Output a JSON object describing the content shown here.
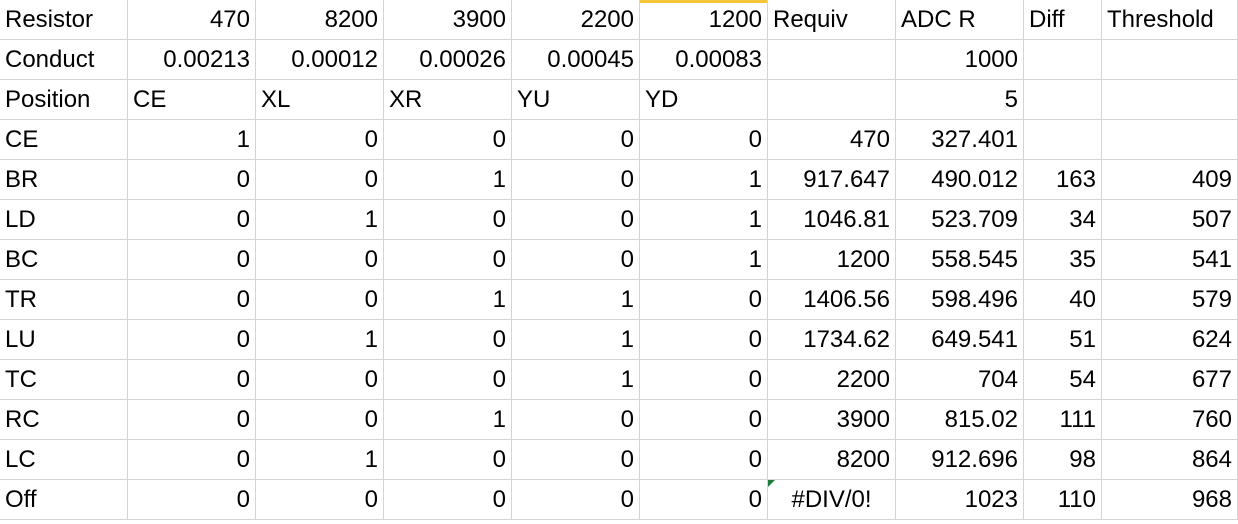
{
  "header_rows": [
    {
      "cells": [
        "Resistor",
        "470",
        "8200",
        "3900",
        "2200",
        "1200",
        "Requiv",
        "ADC R",
        "Diff",
        "Threshold"
      ]
    },
    {
      "cells": [
        "Conduct",
        "0.00213",
        "0.00012",
        "0.00026",
        "0.00045",
        "0.00083",
        "",
        "1000",
        "",
        ""
      ]
    },
    {
      "cells": [
        "Position",
        "CE",
        "XL",
        "XR",
        "YU",
        "YD",
        "",
        "5",
        "",
        ""
      ]
    }
  ],
  "data_rows": [
    {
      "cells": [
        "CE",
        "1",
        "0",
        "0",
        "0",
        "0",
        "470",
        "327.401",
        "",
        ""
      ]
    },
    {
      "cells": [
        "BR",
        "0",
        "0",
        "1",
        "0",
        "1",
        "917.647",
        "490.012",
        "163",
        "409"
      ]
    },
    {
      "cells": [
        "LD",
        "0",
        "1",
        "0",
        "0",
        "1",
        "1046.81",
        "523.709",
        "34",
        "507"
      ]
    },
    {
      "cells": [
        "BC",
        "0",
        "0",
        "0",
        "0",
        "1",
        "1200",
        "558.545",
        "35",
        "541"
      ]
    },
    {
      "cells": [
        "TR",
        "0",
        "0",
        "1",
        "1",
        "0",
        "1406.56",
        "598.496",
        "40",
        "579"
      ]
    },
    {
      "cells": [
        "LU",
        "0",
        "1",
        "0",
        "1",
        "0",
        "1734.62",
        "649.541",
        "51",
        "624"
      ]
    },
    {
      "cells": [
        "TC",
        "0",
        "0",
        "0",
        "1",
        "0",
        "2200",
        "704",
        "54",
        "677"
      ]
    },
    {
      "cells": [
        "RC",
        "0",
        "0",
        "1",
        "0",
        "0",
        "3900",
        "815.02",
        "111",
        "760"
      ]
    },
    {
      "cells": [
        "LC",
        "0",
        "1",
        "0",
        "0",
        "0",
        "8200",
        "912.696",
        "98",
        "864"
      ]
    },
    {
      "cells": [
        "Off",
        "0",
        "0",
        "0",
        "0",
        "0",
        "#DIV/0!",
        "1023",
        "110",
        "968"
      ]
    }
  ],
  "colors": {
    "gridline": "#d4d4d4",
    "text": "#000000",
    "selected_column_accent": "#f5c63c",
    "error_indicator": "#1e7d3c"
  }
}
